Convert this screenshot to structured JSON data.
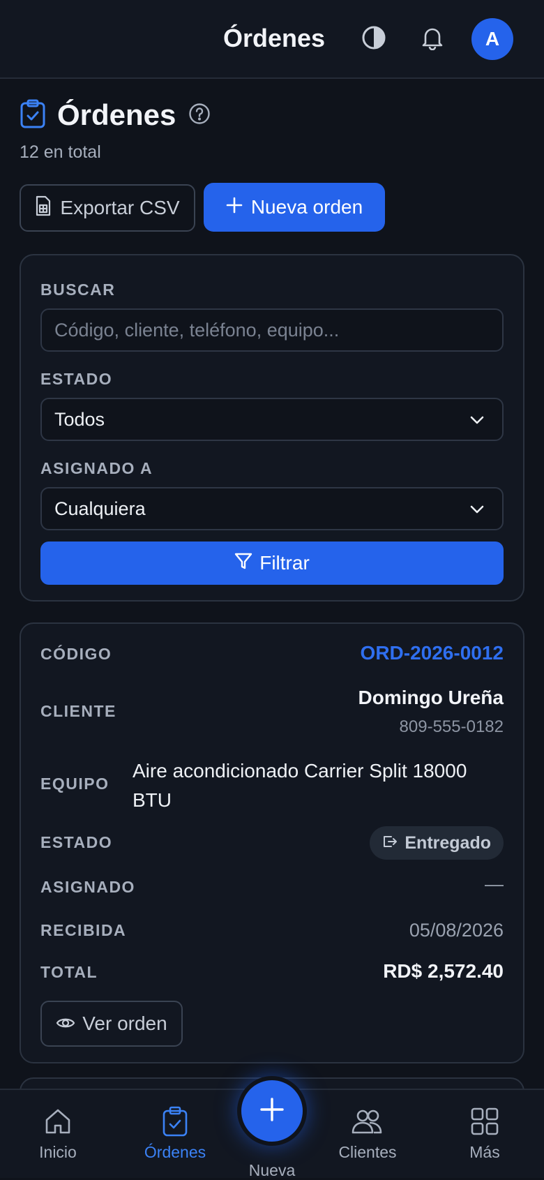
{
  "topbar": {
    "title": "Órdenes",
    "avatar_initial": "A"
  },
  "page": {
    "title": "Órdenes",
    "subtitle": "12 en total"
  },
  "actions": {
    "export": "Exportar CSV",
    "new_order": "Nueva orden"
  },
  "filters": {
    "search_label": "BUSCAR",
    "search_placeholder": "Código, cliente, teléfono, equipo...",
    "status_label": "ESTADO",
    "status_value": "Todos",
    "assigned_label": "ASIGNADO A",
    "assigned_value": "Cualquiera",
    "filter_button": "Filtrar"
  },
  "order": {
    "labels": {
      "code": "CÓDIGO",
      "client": "CLIENTE",
      "equipment": "EQUIPO",
      "status": "ESTADO",
      "assigned": "ASIGNADO",
      "received": "RECIBIDA",
      "total": "TOTAL"
    },
    "code": "ORD-2026-0012",
    "client": "Domingo Ureña",
    "phone": "809-555-0182",
    "equipment": "Aire acondicionado Carrier Split 18000 BTU",
    "status": "Entregado",
    "assigned": "—",
    "received": "05/08/2026",
    "total": "RD$ 2,572.40",
    "view_button": "Ver orden"
  },
  "nav": {
    "home": "Inicio",
    "orders": "Órdenes",
    "new": "Nueva",
    "clients": "Clientes",
    "more": "Más"
  },
  "colors": {
    "accent": "#2563eb",
    "background": "#0f131b",
    "card": "#121721"
  }
}
